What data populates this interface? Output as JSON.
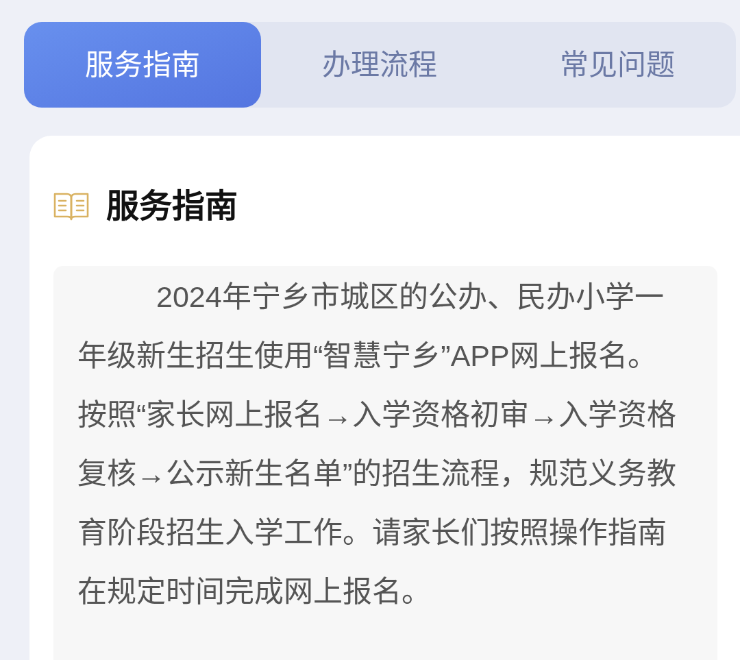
{
  "tabs": [
    {
      "label": "服务指南",
      "selected": true
    },
    {
      "label": "办理流程",
      "selected": false
    },
    {
      "label": "常见问题",
      "selected": false
    }
  ],
  "section": {
    "title": "服务指南",
    "paragraph": "2024年宁乡市城区的公办、民办小学一年级新生招生使用“智慧宁乡”APP网上报名。按照“家长网上报名→入学资格初审→入学资格复核→公示新生名单”的招生流程，规范义务教育阶段招生入学工作。请家长们按照操作指南在规定时间完成网上报名。"
  }
}
